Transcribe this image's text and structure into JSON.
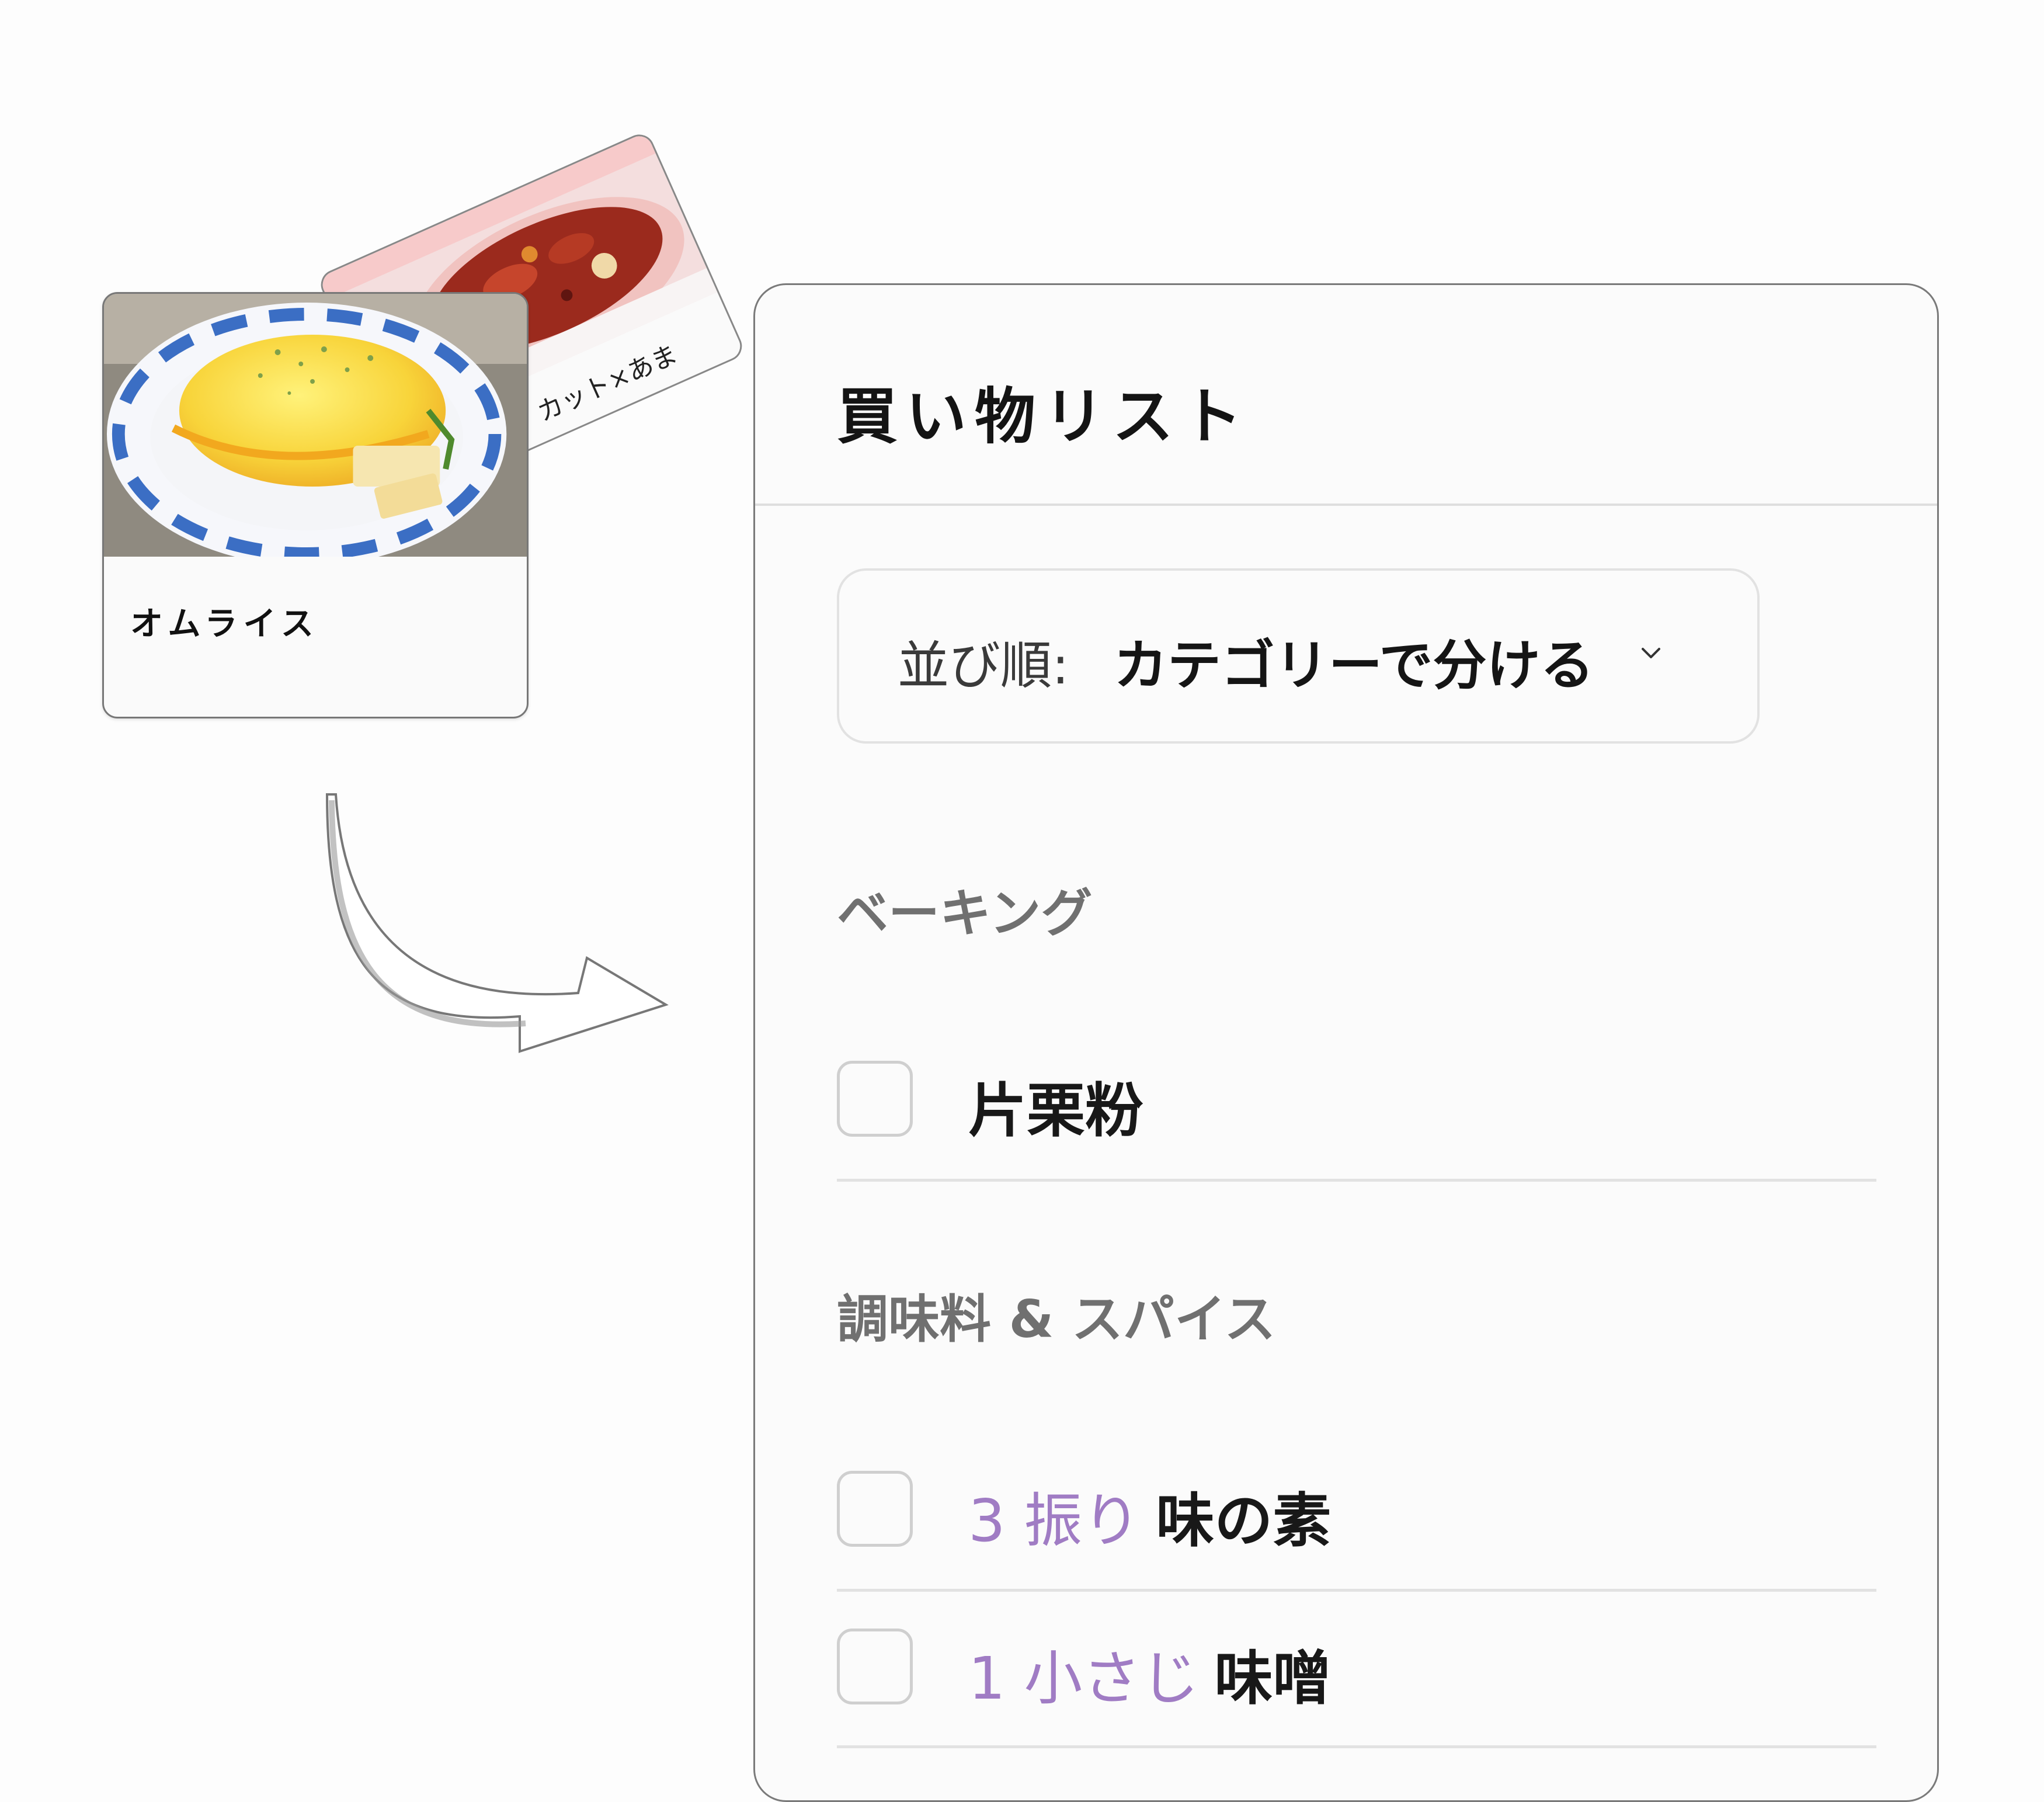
{
  "recipes": {
    "back_card_title": "カット×あま",
    "front_card_title": "オムライス"
  },
  "panel": {
    "title": "買い物リスト"
  },
  "sort": {
    "label": "並び順:",
    "value": "カテゴリーで分ける",
    "icon": "chevron-down-icon"
  },
  "categories": [
    {
      "name": "ベーキング",
      "items": [
        {
          "quantity": "",
          "name": "片栗粉"
        }
      ]
    },
    {
      "name": "調味料 & スパイス",
      "items": [
        {
          "quantity": "3 振り",
          "name": "味の素"
        },
        {
          "quantity": "1 小さじ",
          "name": "味噌"
        }
      ]
    }
  ],
  "colors": {
    "quantity": "#a07cc4",
    "category": "#707070",
    "border": "#7a7a7a"
  }
}
